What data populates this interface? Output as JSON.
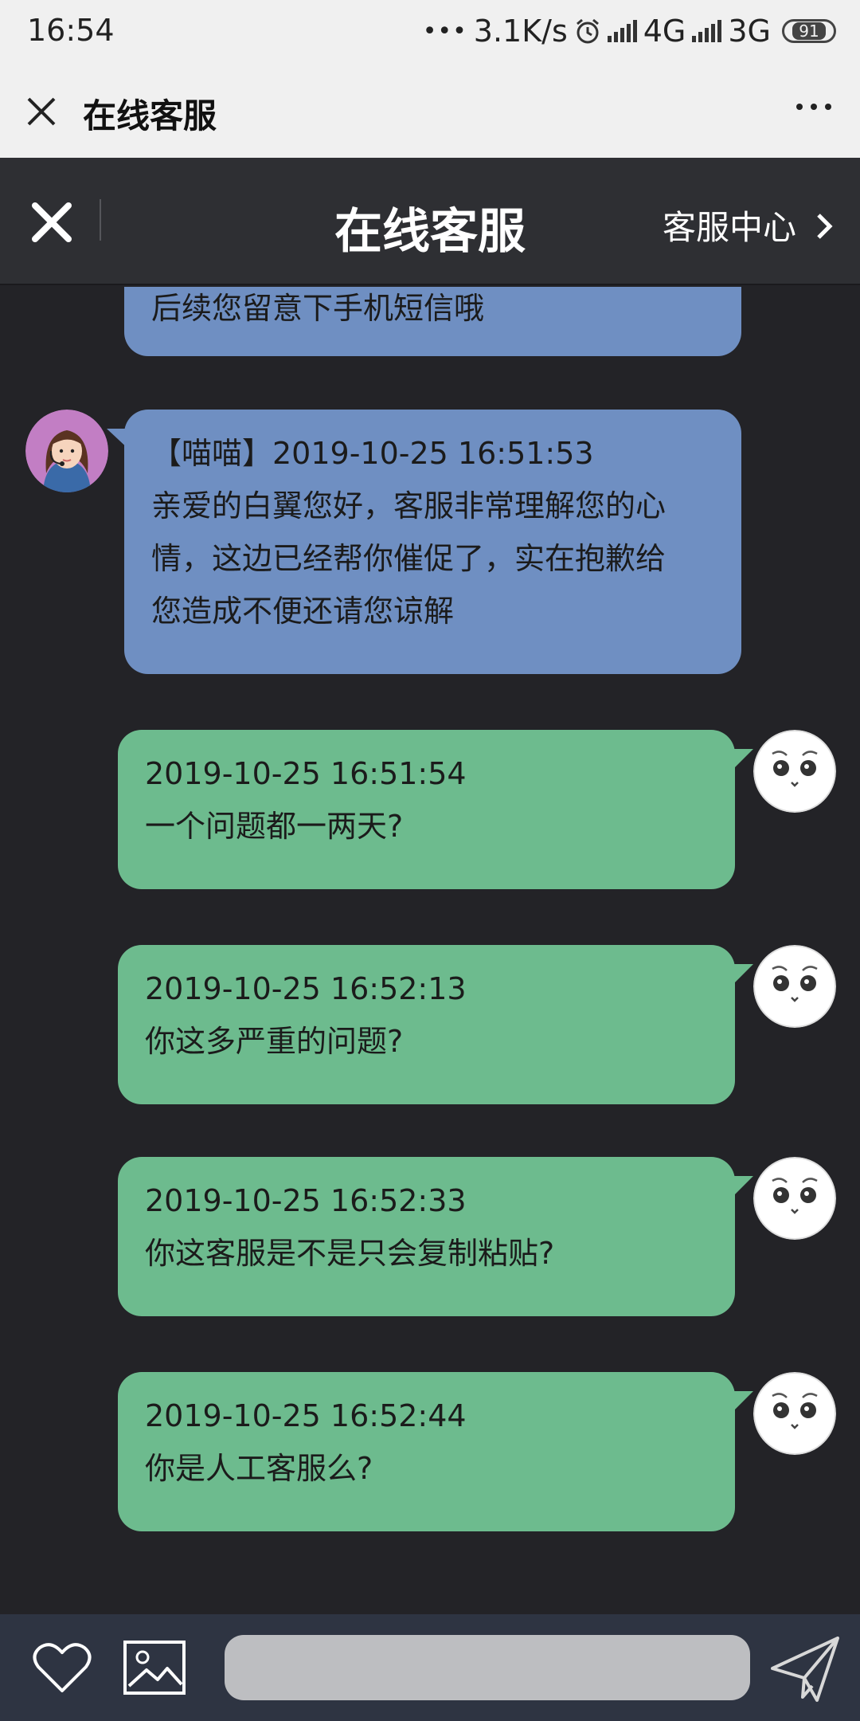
{
  "status_bar": {
    "time": "16:54",
    "speed": "3.1K/s",
    "network_1": "4G",
    "network_2": "3G",
    "battery": "91"
  },
  "webview": {
    "title": "在线客服"
  },
  "header": {
    "title": "在线客服",
    "service_center": "客服中心"
  },
  "messages": [
    {
      "sender": "agent",
      "lines": [
        "后续您留意下手机短信哦"
      ]
    },
    {
      "sender": "agent",
      "lines": [
        "【喵喵】2019-10-25 16:51:53",
        "亲爱的白翼您好，客服非常理解您的心",
        "情，这边已经帮你催促了，实在抱歉给",
        "您造成不便还请您谅解"
      ]
    },
    {
      "sender": "user",
      "lines": [
        "2019-10-25 16:51:54",
        "一个问题都一两天?"
      ]
    },
    {
      "sender": "user",
      "lines": [
        "2019-10-25 16:52:13",
        "你这多严重的问题?"
      ]
    },
    {
      "sender": "user",
      "lines": [
        "2019-10-25 16:52:33",
        "你这客服是不是只会复制粘贴?"
      ]
    },
    {
      "sender": "user",
      "lines": [
        "2019-10-25 16:52:44",
        "你是人工客服么?"
      ]
    }
  ],
  "colors": {
    "agent_bubble": "#6f8fc2",
    "user_bubble": "#6dbb8e",
    "chat_background": "#232327",
    "header_background": "#2e2f33"
  },
  "icons": {
    "favorite": "heart-icon",
    "image": "image-icon",
    "send": "send-icon"
  }
}
